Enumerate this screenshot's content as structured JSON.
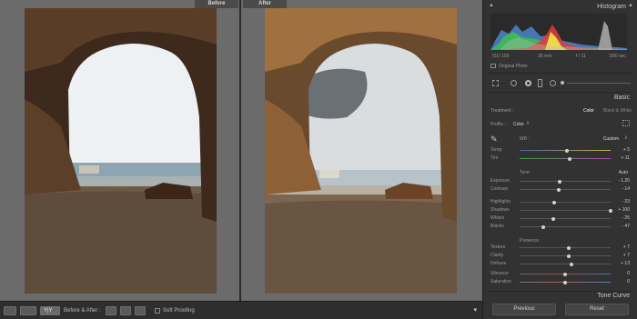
{
  "compare": {
    "before_label": "Before",
    "after_label": "After"
  },
  "toolbar": {
    "mode_label": "Y|Y",
    "before_after_label": "Before & After :",
    "soft_proofing_label": "Soft Proofing",
    "soft_proofing_checked": false
  },
  "histogram": {
    "title": "Histogram",
    "iso": "ISO 100",
    "focal": "35 mm",
    "aperture": "f / 11",
    "shutter": "1/80 sec",
    "source_label": "Original Photo"
  },
  "basic": {
    "title": "Basic",
    "treatment_label": "Treatment :",
    "treatment_options": [
      "Color",
      "Black & White"
    ],
    "treatment_selected": "Color",
    "profile_label": "Profile :",
    "profile_value": "Color",
    "wb_label": "WB :",
    "wb_value": "Custom",
    "tone_label": "Tone",
    "tone_auto_label": "Auto",
    "presence_label": "Presence",
    "sliders": [
      {
        "label": "Temp",
        "value": "+ 5",
        "level": 0.52
      },
      {
        "label": "Tint",
        "value": "+ 11",
        "level": 0.55
      },
      {
        "label": "Exposure",
        "value": "- 1.20",
        "level": 0.44
      },
      {
        "label": "Contrast",
        "value": "- 14",
        "level": 0.43
      },
      {
        "label": "Highlights",
        "value": "- 23",
        "level": 0.38
      },
      {
        "label": "Shadows",
        "value": "+ 100",
        "level": 1.0
      },
      {
        "label": "Whites",
        "value": "- 25",
        "level": 0.37
      },
      {
        "label": "Blacks",
        "value": "- 47",
        "level": 0.26
      },
      {
        "label": "Texture",
        "value": "+ 7",
        "level": 0.54
      },
      {
        "label": "Clarity",
        "value": "+ 7",
        "level": 0.54
      },
      {
        "label": "Dehaze",
        "value": "+ 13",
        "level": 0.57
      },
      {
        "label": "Vibrance",
        "value": "0",
        "level": 0.5
      },
      {
        "label": "Saturation",
        "value": "0",
        "level": 0.5
      }
    ]
  },
  "tone_curve_title": "Tone Curve",
  "previous_label": "Previous",
  "reset_label": "Reset",
  "colors": {
    "panel_bg": "#323232",
    "accent": "#e8e8e8"
  }
}
